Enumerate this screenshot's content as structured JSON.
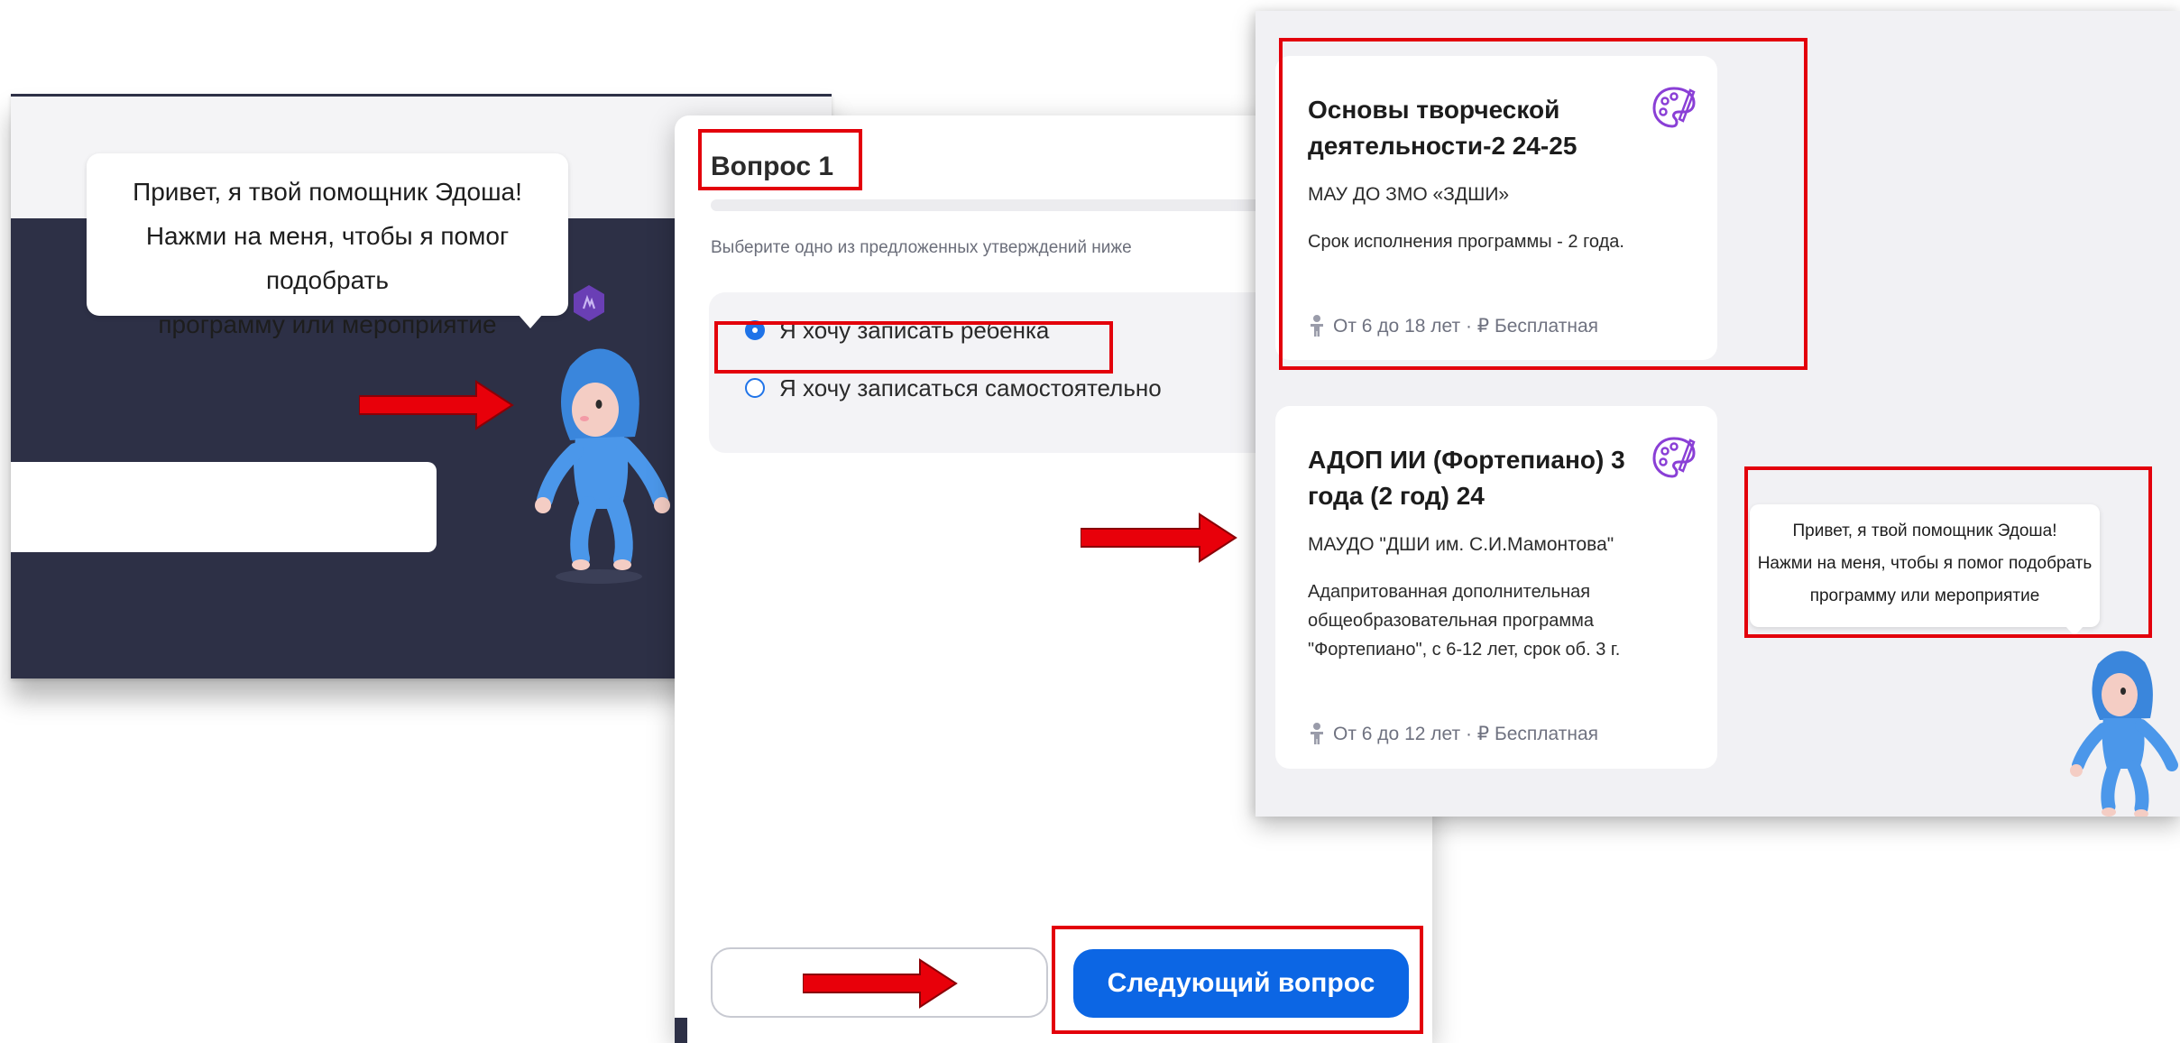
{
  "panel_assistant": {
    "bubble_lines": [
      "Привет, я твой помощник Эдоша!",
      "Нажми на меня, чтобы я помог подобрать",
      "программу или мероприятие"
    ]
  },
  "panel_quiz": {
    "title": "Вопрос 1",
    "hint": "Выберите одно из предложенных утверждений ниже",
    "options": [
      {
        "label": "Я хочу записать ребенка",
        "selected": true
      },
      {
        "label": "Я хочу записаться самостоятельно",
        "selected": false
      }
    ],
    "back_label": "",
    "next_label": "Следующий вопрос"
  },
  "panel_results": {
    "cards": [
      {
        "title": "Основы творческой деятельности-2 24-25",
        "org": "МАУ ДО ЗМО «ЗДШИ»",
        "desc": "Срок исполнения программы - 2 года.",
        "meta": "От 6 до 18 лет · ₽ Бесплатная"
      },
      {
        "title": "АДОП ИИ (Фортепиано) 3 года (2 год) 24",
        "org": "МАУДО \"ДШИ им. С.И.Мамонтова\"",
        "desc": "Адапритованная дополнительная общеобразовательная программа \"Фортепиано\", с 6-12 лет, срок об. 3 г.",
        "meta": "От 6 до 12 лет · ₽ Бесплатная"
      }
    ],
    "bubble_lines": [
      "Привет, я твой помощник Эдоша!",
      "Нажми на меня, чтобы я помог подобрать",
      "программу или мероприятие"
    ]
  },
  "colors": {
    "dark_bg": "#2d3046",
    "primary_blue": "#0c66e4",
    "highlight_red": "#e3000b",
    "arrow_red": "#e8000a"
  },
  "icons": [
    "palette-icon",
    "child-icon",
    "mascot-edosha",
    "assistant-badge-icon",
    "red-arrow"
  ]
}
